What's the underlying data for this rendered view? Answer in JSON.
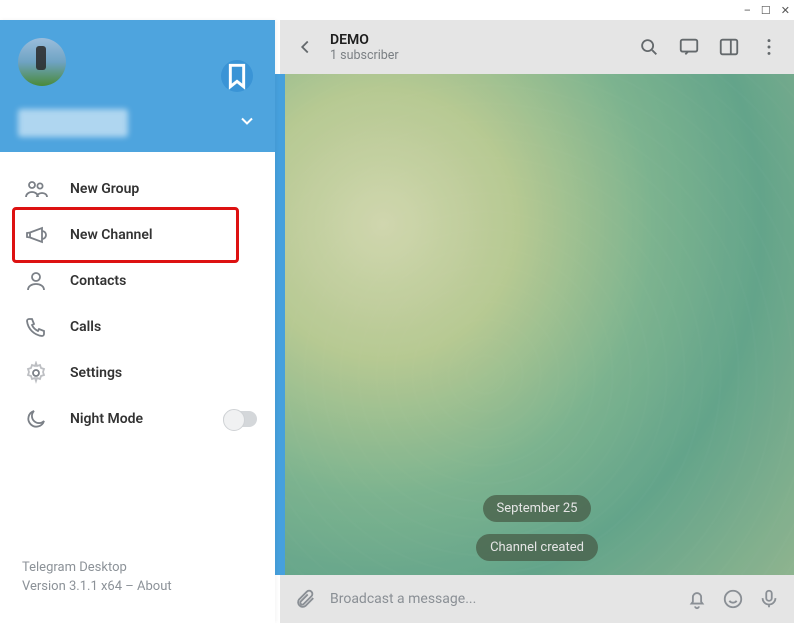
{
  "window_controls": {
    "min": "–",
    "max": "☐",
    "close": "✕"
  },
  "chat": {
    "title": "DEMO",
    "subtitle": "1 subscriber",
    "date_chip": "September 25",
    "event_chip": "Channel created",
    "compose_placeholder": "Broadcast a message..."
  },
  "drawer": {
    "menu": {
      "new_group": "New Group",
      "new_channel": "New Channel",
      "contacts": "Contacts",
      "calls": "Calls",
      "settings": "Settings",
      "night_mode": "Night Mode"
    },
    "footer": {
      "app": "Telegram Desktop",
      "version_prefix": "Version 3.1.1 x64 – ",
      "about": "About"
    }
  }
}
